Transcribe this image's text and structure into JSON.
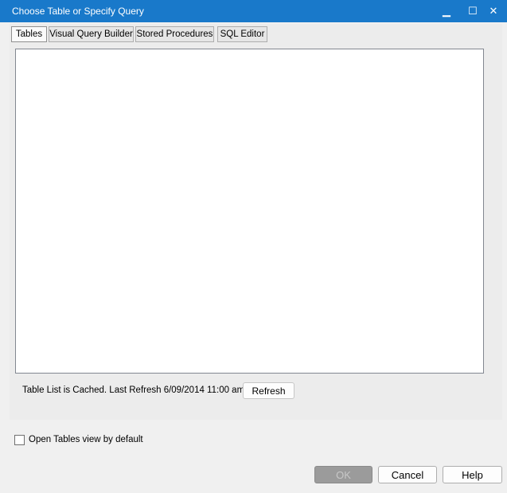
{
  "window": {
    "title": "Choose Table or Specify Query",
    "minimize_glyph": "▁",
    "maximize_glyph": "☐",
    "close_glyph": "✕"
  },
  "tabs": [
    {
      "label": "Tables",
      "active": true
    },
    {
      "label": "Visual Query Builder",
      "active": false
    },
    {
      "label": "Stored Procedures",
      "active": false
    },
    {
      "label": "SQL Editor",
      "active": false
    }
  ],
  "status": {
    "cache_text": "Table List is Cached.  Last Refresh 6/09/2014 11:00 am",
    "refresh_label": "Refresh"
  },
  "options": {
    "open_tables_default_label": "Open Tables view by default",
    "open_tables_default_checked": false
  },
  "buttons": {
    "ok_label": "OK",
    "ok_enabled": false,
    "cancel_label": "Cancel",
    "help_label": "Help"
  },
  "colors": {
    "titlebar": "#1979ca",
    "panel": "#ececec",
    "background": "#f0f0f0"
  }
}
